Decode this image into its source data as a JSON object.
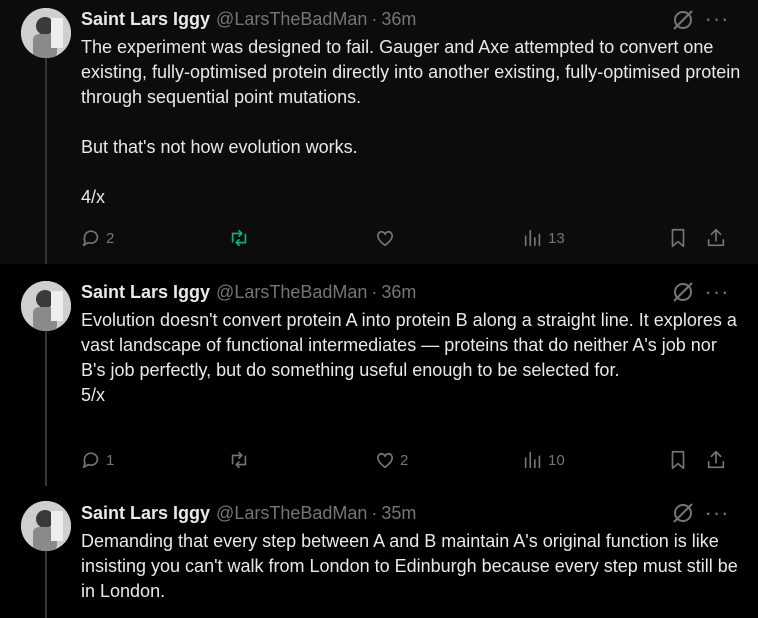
{
  "tweets": [
    {
      "author_name": "Saint Lars Iggy",
      "handle": "@LarsTheBadMan",
      "separator": "·",
      "time": "36m",
      "text": "The experiment was designed to fail. Gauger and Axe attempted to convert one existing, fully-optimised protein directly into another existing, fully-optimised protein through sequential point mutations.\n\nBut that's not how evolution works.\n\n4/x",
      "replies": "2",
      "reposts": "",
      "likes": "",
      "views": "13"
    },
    {
      "author_name": "Saint Lars Iggy",
      "handle": "@LarsTheBadMan",
      "separator": "·",
      "time": "36m",
      "text": "Evolution doesn't convert protein A into protein B along a straight line. It explores a vast landscape of functional intermediates — proteins that do neither A's job nor B's job perfectly, but do something useful enough to be selected for.\n5/x",
      "replies": "1",
      "reposts": "",
      "likes": "2",
      "views": "10"
    },
    {
      "author_name": "Saint Lars Iggy",
      "handle": "@LarsTheBadMan",
      "separator": "·",
      "time": "35m",
      "text": "Demanding that every step between A and B maintain A's original function is like insisting you can't walk from London to Edinburgh because every step must still be in London."
    }
  ],
  "icons": {
    "more": "···",
    "grok": "grok-icon",
    "reply": "reply-icon",
    "repost": "repost-icon",
    "like": "heart-icon",
    "views": "views-icon",
    "bookmark": "bookmark-icon",
    "share": "share-icon"
  },
  "colors": {
    "background": "#000000",
    "highlight_background": "#0c0c0c",
    "text": "#e7e9ea",
    "muted": "#71767b",
    "repost_active": "#00ba7c",
    "thread_line": "#333639"
  }
}
